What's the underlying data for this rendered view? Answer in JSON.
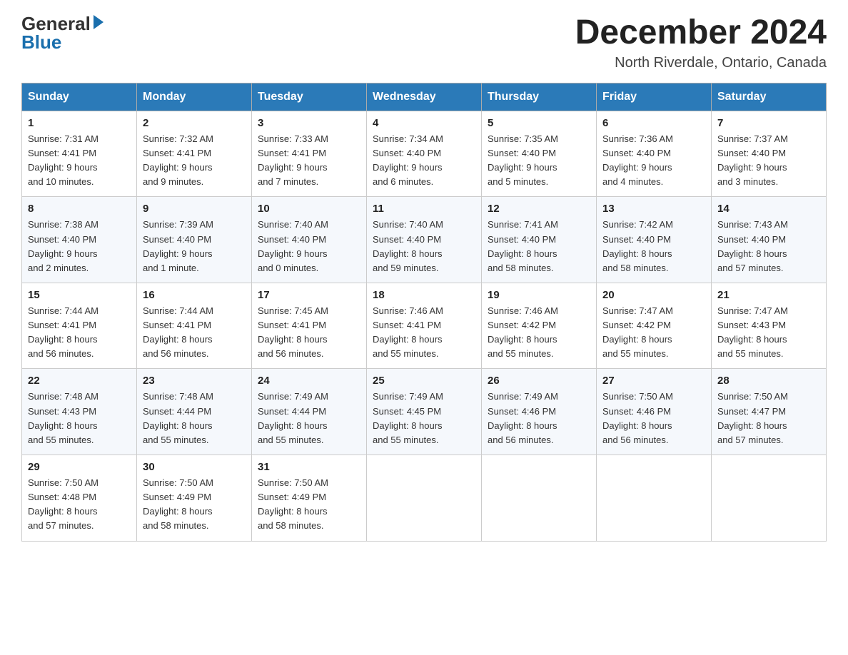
{
  "header": {
    "logo_general": "General",
    "logo_blue": "Blue",
    "month_title": "December 2024",
    "location": "North Riverdale, Ontario, Canada"
  },
  "weekdays": [
    "Sunday",
    "Monday",
    "Tuesday",
    "Wednesday",
    "Thursday",
    "Friday",
    "Saturday"
  ],
  "weeks": [
    [
      {
        "day": "1",
        "sunrise": "Sunrise: 7:31 AM",
        "sunset": "Sunset: 4:41 PM",
        "daylight": "Daylight: 9 hours",
        "daylight2": "and 10 minutes."
      },
      {
        "day": "2",
        "sunrise": "Sunrise: 7:32 AM",
        "sunset": "Sunset: 4:41 PM",
        "daylight": "Daylight: 9 hours",
        "daylight2": "and 9 minutes."
      },
      {
        "day": "3",
        "sunrise": "Sunrise: 7:33 AM",
        "sunset": "Sunset: 4:41 PM",
        "daylight": "Daylight: 9 hours",
        "daylight2": "and 7 minutes."
      },
      {
        "day": "4",
        "sunrise": "Sunrise: 7:34 AM",
        "sunset": "Sunset: 4:40 PM",
        "daylight": "Daylight: 9 hours",
        "daylight2": "and 6 minutes."
      },
      {
        "day": "5",
        "sunrise": "Sunrise: 7:35 AM",
        "sunset": "Sunset: 4:40 PM",
        "daylight": "Daylight: 9 hours",
        "daylight2": "and 5 minutes."
      },
      {
        "day": "6",
        "sunrise": "Sunrise: 7:36 AM",
        "sunset": "Sunset: 4:40 PM",
        "daylight": "Daylight: 9 hours",
        "daylight2": "and 4 minutes."
      },
      {
        "day": "7",
        "sunrise": "Sunrise: 7:37 AM",
        "sunset": "Sunset: 4:40 PM",
        "daylight": "Daylight: 9 hours",
        "daylight2": "and 3 minutes."
      }
    ],
    [
      {
        "day": "8",
        "sunrise": "Sunrise: 7:38 AM",
        "sunset": "Sunset: 4:40 PM",
        "daylight": "Daylight: 9 hours",
        "daylight2": "and 2 minutes."
      },
      {
        "day": "9",
        "sunrise": "Sunrise: 7:39 AM",
        "sunset": "Sunset: 4:40 PM",
        "daylight": "Daylight: 9 hours",
        "daylight2": "and 1 minute."
      },
      {
        "day": "10",
        "sunrise": "Sunrise: 7:40 AM",
        "sunset": "Sunset: 4:40 PM",
        "daylight": "Daylight: 9 hours",
        "daylight2": "and 0 minutes."
      },
      {
        "day": "11",
        "sunrise": "Sunrise: 7:40 AM",
        "sunset": "Sunset: 4:40 PM",
        "daylight": "Daylight: 8 hours",
        "daylight2": "and 59 minutes."
      },
      {
        "day": "12",
        "sunrise": "Sunrise: 7:41 AM",
        "sunset": "Sunset: 4:40 PM",
        "daylight": "Daylight: 8 hours",
        "daylight2": "and 58 minutes."
      },
      {
        "day": "13",
        "sunrise": "Sunrise: 7:42 AM",
        "sunset": "Sunset: 4:40 PM",
        "daylight": "Daylight: 8 hours",
        "daylight2": "and 58 minutes."
      },
      {
        "day": "14",
        "sunrise": "Sunrise: 7:43 AM",
        "sunset": "Sunset: 4:40 PM",
        "daylight": "Daylight: 8 hours",
        "daylight2": "and 57 minutes."
      }
    ],
    [
      {
        "day": "15",
        "sunrise": "Sunrise: 7:44 AM",
        "sunset": "Sunset: 4:41 PM",
        "daylight": "Daylight: 8 hours",
        "daylight2": "and 56 minutes."
      },
      {
        "day": "16",
        "sunrise": "Sunrise: 7:44 AM",
        "sunset": "Sunset: 4:41 PM",
        "daylight": "Daylight: 8 hours",
        "daylight2": "and 56 minutes."
      },
      {
        "day": "17",
        "sunrise": "Sunrise: 7:45 AM",
        "sunset": "Sunset: 4:41 PM",
        "daylight": "Daylight: 8 hours",
        "daylight2": "and 56 minutes."
      },
      {
        "day": "18",
        "sunrise": "Sunrise: 7:46 AM",
        "sunset": "Sunset: 4:41 PM",
        "daylight": "Daylight: 8 hours",
        "daylight2": "and 55 minutes."
      },
      {
        "day": "19",
        "sunrise": "Sunrise: 7:46 AM",
        "sunset": "Sunset: 4:42 PM",
        "daylight": "Daylight: 8 hours",
        "daylight2": "and 55 minutes."
      },
      {
        "day": "20",
        "sunrise": "Sunrise: 7:47 AM",
        "sunset": "Sunset: 4:42 PM",
        "daylight": "Daylight: 8 hours",
        "daylight2": "and 55 minutes."
      },
      {
        "day": "21",
        "sunrise": "Sunrise: 7:47 AM",
        "sunset": "Sunset: 4:43 PM",
        "daylight": "Daylight: 8 hours",
        "daylight2": "and 55 minutes."
      }
    ],
    [
      {
        "day": "22",
        "sunrise": "Sunrise: 7:48 AM",
        "sunset": "Sunset: 4:43 PM",
        "daylight": "Daylight: 8 hours",
        "daylight2": "and 55 minutes."
      },
      {
        "day": "23",
        "sunrise": "Sunrise: 7:48 AM",
        "sunset": "Sunset: 4:44 PM",
        "daylight": "Daylight: 8 hours",
        "daylight2": "and 55 minutes."
      },
      {
        "day": "24",
        "sunrise": "Sunrise: 7:49 AM",
        "sunset": "Sunset: 4:44 PM",
        "daylight": "Daylight: 8 hours",
        "daylight2": "and 55 minutes."
      },
      {
        "day": "25",
        "sunrise": "Sunrise: 7:49 AM",
        "sunset": "Sunset: 4:45 PM",
        "daylight": "Daylight: 8 hours",
        "daylight2": "and 55 minutes."
      },
      {
        "day": "26",
        "sunrise": "Sunrise: 7:49 AM",
        "sunset": "Sunset: 4:46 PM",
        "daylight": "Daylight: 8 hours",
        "daylight2": "and 56 minutes."
      },
      {
        "day": "27",
        "sunrise": "Sunrise: 7:50 AM",
        "sunset": "Sunset: 4:46 PM",
        "daylight": "Daylight: 8 hours",
        "daylight2": "and 56 minutes."
      },
      {
        "day": "28",
        "sunrise": "Sunrise: 7:50 AM",
        "sunset": "Sunset: 4:47 PM",
        "daylight": "Daylight: 8 hours",
        "daylight2": "and 57 minutes."
      }
    ],
    [
      {
        "day": "29",
        "sunrise": "Sunrise: 7:50 AM",
        "sunset": "Sunset: 4:48 PM",
        "daylight": "Daylight: 8 hours",
        "daylight2": "and 57 minutes."
      },
      {
        "day": "30",
        "sunrise": "Sunrise: 7:50 AM",
        "sunset": "Sunset: 4:49 PM",
        "daylight": "Daylight: 8 hours",
        "daylight2": "and 58 minutes."
      },
      {
        "day": "31",
        "sunrise": "Sunrise: 7:50 AM",
        "sunset": "Sunset: 4:49 PM",
        "daylight": "Daylight: 8 hours",
        "daylight2": "and 58 minutes."
      },
      null,
      null,
      null,
      null
    ]
  ]
}
